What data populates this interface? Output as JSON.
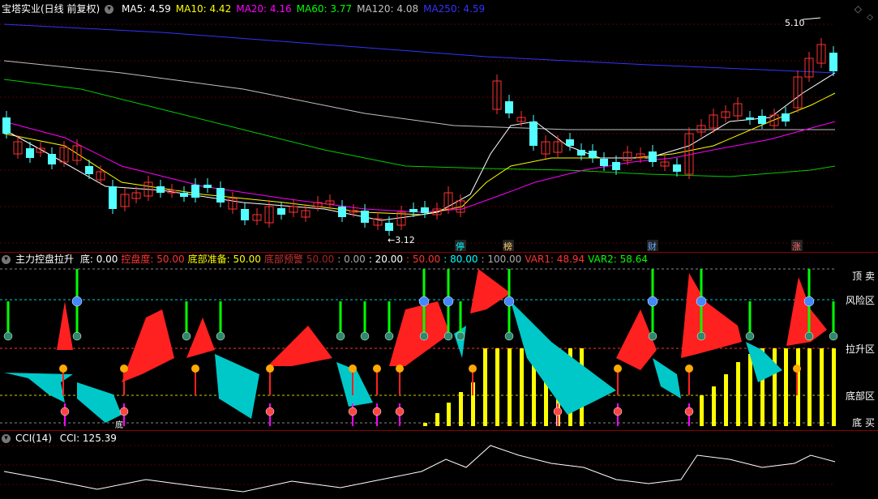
{
  "main": {
    "title": "宝塔实业(日线 前复权)",
    "ma": [
      {
        "label": "MA5: 4.59",
        "color": "#ffffff"
      },
      {
        "label": "MA10: 4.42",
        "color": "#ffff00"
      },
      {
        "label": "MA20: 4.16",
        "color": "#ff00ff"
      },
      {
        "label": "MA60: 3.77",
        "color": "#00ff00"
      },
      {
        "label": "MA120: 4.08",
        "color": "#c0c0c0"
      },
      {
        "label": "MA250: 4.59",
        "color": "#3333ff"
      }
    ],
    "high_label": "5.10",
    "low_label": "3.12",
    "markers": [
      {
        "text": "停",
        "color": "#00ffff"
      },
      {
        "text": "榜",
        "color": "#ffcc66"
      },
      {
        "text": "财",
        "color": "#66aaff"
      },
      {
        "text": "涨",
        "color": "#ff6666"
      }
    ]
  },
  "indicator": {
    "title": "主力控盘拉升",
    "values": [
      {
        "label": "底: 0.00",
        "color": "#ffffff"
      },
      {
        "label": "控盘度: 50.00",
        "color": "#ff3333"
      },
      {
        "label": "底部准备: 50.00",
        "color": "#ffff00"
      },
      {
        "label": "底部预警",
        "color": "#cc3333"
      },
      {
        "label": "50.00",
        "color": "#aa2222"
      },
      {
        "label": ": 0.00",
        "color": "#aaaaaa"
      },
      {
        "label": ": 20.00",
        "color": "#ffffff"
      },
      {
        "label": ": 50.00",
        "color": "#ff3333"
      },
      {
        "label": ": 80.00",
        "color": "#00ffff"
      },
      {
        "label": ": 100.00",
        "color": "#aaaaaa"
      },
      {
        "label": "VAR1: 48.94",
        "color": "#ff3333"
      },
      {
        "label": "VAR2: 58.64",
        "color": "#00ff00"
      }
    ],
    "zones": [
      "顶 卖",
      "风险区",
      "拉升区",
      "底部区",
      "底 买"
    ],
    "bottom_tag": "底"
  },
  "cci": {
    "title": "CCI(14)",
    "value": "CCI: 125.39"
  }
}
